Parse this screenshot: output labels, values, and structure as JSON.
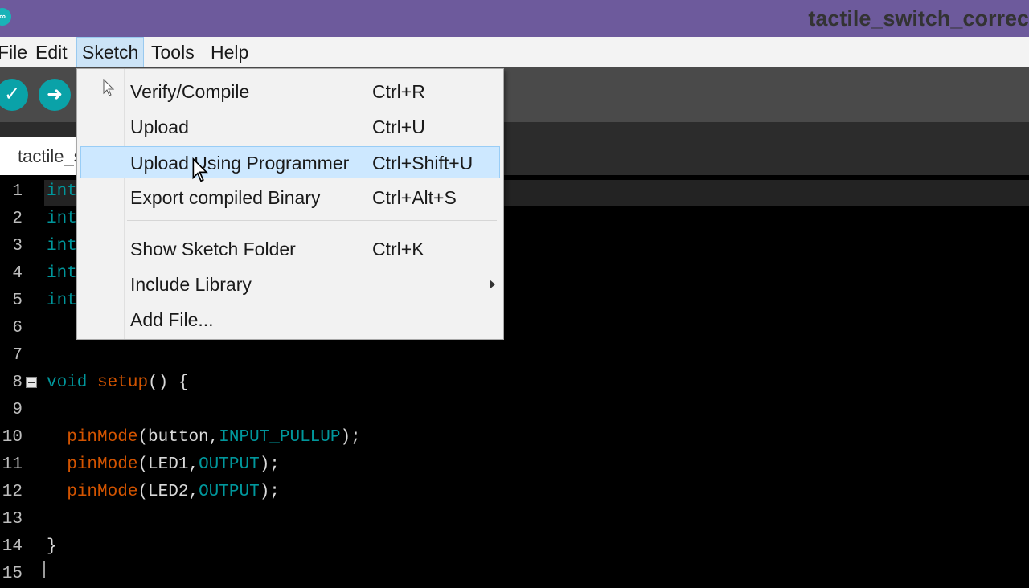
{
  "window": {
    "title": "tactile_switch_correc",
    "logo_text": "∞"
  },
  "menubar": {
    "items": [
      {
        "label": "File"
      },
      {
        "label": "Edit"
      },
      {
        "label": "Sketch"
      },
      {
        "label": "Tools"
      },
      {
        "label": "Help"
      }
    ],
    "active": "Sketch"
  },
  "toolbar": {
    "buttons": [
      {
        "icon": "checkmark-icon",
        "glyph": "✓"
      },
      {
        "icon": "arrow-right-icon",
        "glyph": "➜"
      }
    ]
  },
  "tabs": [
    {
      "label": "tactile_switch_correct"
    }
  ],
  "sketch_menu": {
    "items": [
      {
        "label": "Verify/Compile",
        "shortcut": "Ctrl+R"
      },
      {
        "label": "Upload",
        "shortcut": "Ctrl+U"
      },
      {
        "label": "Upload Using Programmer",
        "shortcut": "Ctrl+Shift+U",
        "highlighted": true
      },
      {
        "label": "Export compiled Binary",
        "shortcut": "Ctrl+Alt+S"
      },
      {
        "label": "Show Sketch Folder",
        "shortcut": "Ctrl+K"
      },
      {
        "label": "Include Library",
        "shortcut": "",
        "submenu": true
      },
      {
        "label": "Add File...",
        "shortcut": ""
      }
    ]
  },
  "editor": {
    "lines": [
      {
        "number": "1",
        "tokens": [
          {
            "text": "int",
            "type": "keyword"
          }
        ]
      },
      {
        "number": "2",
        "tokens": [
          {
            "text": "int",
            "type": "keyword"
          }
        ]
      },
      {
        "number": "3",
        "tokens": [
          {
            "text": "int",
            "type": "keyword"
          }
        ]
      },
      {
        "number": "4",
        "tokens": [
          {
            "text": "int",
            "type": "keyword"
          }
        ]
      },
      {
        "number": "5",
        "tokens": [
          {
            "text": "int",
            "type": "keyword"
          }
        ]
      },
      {
        "number": "6",
        "tokens": []
      },
      {
        "number": "7",
        "tokens": []
      },
      {
        "number": "8",
        "tokens": [
          {
            "text": "void",
            "type": "keyword"
          },
          {
            "text": " ",
            "type": "text"
          },
          {
            "text": "setup",
            "type": "function"
          },
          {
            "text": "() {",
            "type": "text"
          }
        ]
      },
      {
        "number": "9",
        "tokens": []
      },
      {
        "number": "10",
        "tokens": [
          {
            "text": "  ",
            "type": "text"
          },
          {
            "text": "pinMode",
            "type": "function"
          },
          {
            "text": "(button,",
            "type": "text"
          },
          {
            "text": "INPUT_PULLUP",
            "type": "keyword"
          },
          {
            "text": ");",
            "type": "text"
          }
        ]
      },
      {
        "number": "11",
        "tokens": [
          {
            "text": "  ",
            "type": "text"
          },
          {
            "text": "pinMode",
            "type": "function"
          },
          {
            "text": "(LED1,",
            "type": "text"
          },
          {
            "text": "OUTPUT",
            "type": "keyword"
          },
          {
            "text": ");",
            "type": "text"
          }
        ]
      },
      {
        "number": "12",
        "tokens": [
          {
            "text": "  ",
            "type": "text"
          },
          {
            "text": "pinMode",
            "type": "function"
          },
          {
            "text": "(LED2,",
            "type": "text"
          },
          {
            "text": "OUTPUT",
            "type": "keyword"
          },
          {
            "text": ");",
            "type": "text"
          }
        ]
      },
      {
        "number": "13",
        "tokens": []
      },
      {
        "number": "14",
        "tokens": [
          {
            "text": "}",
            "type": "text"
          }
        ]
      },
      {
        "number": "15",
        "tokens": []
      }
    ]
  },
  "colors": {
    "titlebar": "#6d5a9c",
    "toolbar": "#4a4a4a",
    "accent": "#00979c",
    "function": "#d35400",
    "highlight": "#cde8ff"
  }
}
